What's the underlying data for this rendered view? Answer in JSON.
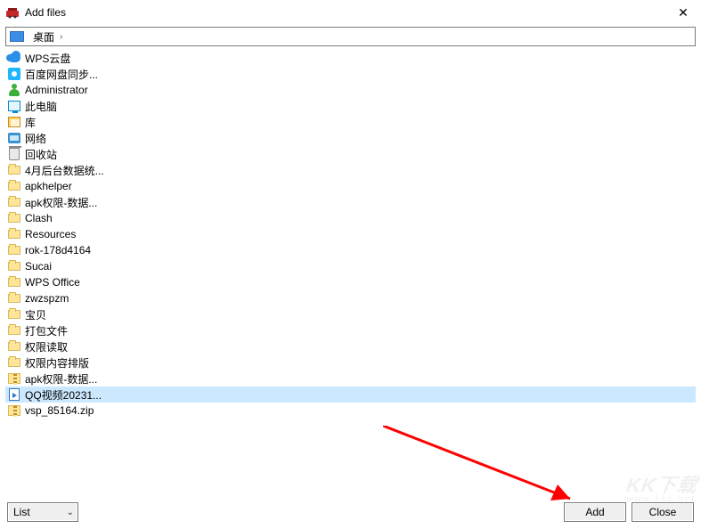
{
  "window": {
    "title": "Add files",
    "close_glyph": "✕"
  },
  "path": {
    "segment": "桌面",
    "chevron": "›"
  },
  "items": [
    {
      "icon": "cloud",
      "label": "WPS云盘"
    },
    {
      "icon": "baidu",
      "label": "百度网盘同步..."
    },
    {
      "icon": "user",
      "label": "Administrator"
    },
    {
      "icon": "pc",
      "label": "此电脑"
    },
    {
      "icon": "lib",
      "label": "库"
    },
    {
      "icon": "net",
      "label": "网络"
    },
    {
      "icon": "bin",
      "label": "回收站"
    },
    {
      "icon": "folder",
      "label": "4月后台数据统..."
    },
    {
      "icon": "folder",
      "label": "apkhelper"
    },
    {
      "icon": "folder",
      "label": "apk权限-数据..."
    },
    {
      "icon": "folder",
      "label": "Clash"
    },
    {
      "icon": "folder",
      "label": "Resources"
    },
    {
      "icon": "folder",
      "label": "rok-178d4164"
    },
    {
      "icon": "folder",
      "label": "Sucai"
    },
    {
      "icon": "folder",
      "label": "WPS Office"
    },
    {
      "icon": "folder",
      "label": "zwzspzm"
    },
    {
      "icon": "folder",
      "label": "宝贝"
    },
    {
      "icon": "folder",
      "label": "打包文件"
    },
    {
      "icon": "folder",
      "label": "权限读取"
    },
    {
      "icon": "folder",
      "label": "权限内容排版"
    },
    {
      "icon": "zip",
      "label": "apk权限-数据..."
    },
    {
      "icon": "video",
      "label": "QQ视频20231...",
      "selected": true
    },
    {
      "icon": "zip",
      "label": "vsp_85164.zip"
    }
  ],
  "view_select": {
    "label": "List",
    "chevron": "⌄"
  },
  "buttons": {
    "add": "Add",
    "close": "Close"
  },
  "watermark": {
    "main": "KK下载",
    "sub": "www.kkx.net"
  }
}
